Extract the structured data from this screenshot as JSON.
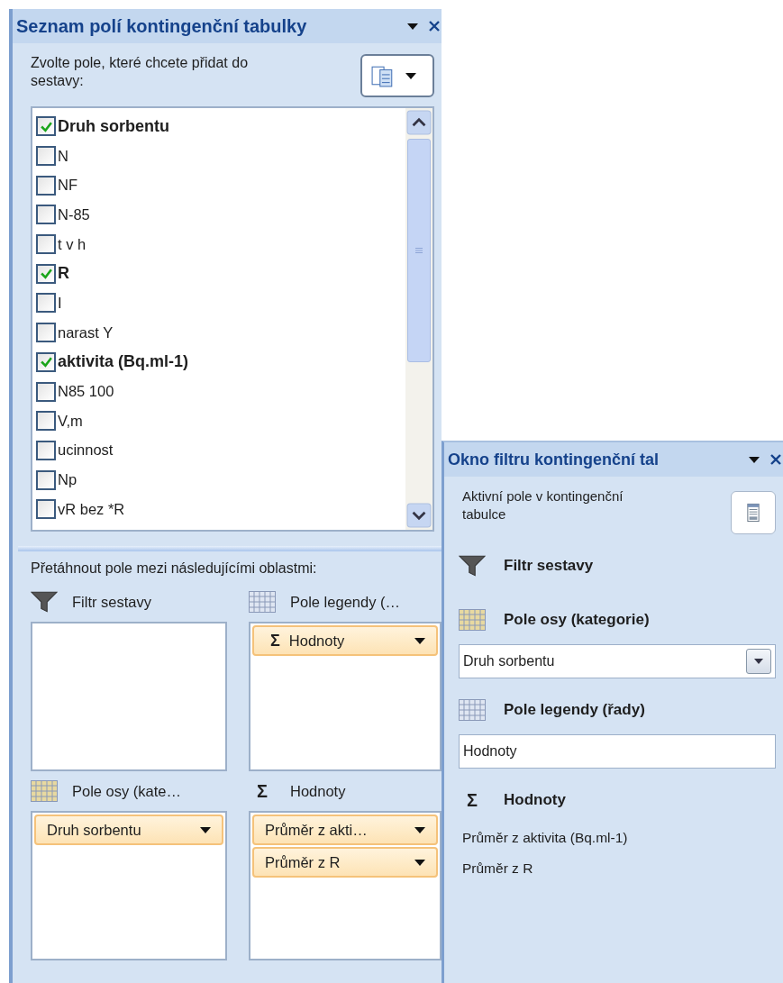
{
  "field_list_pane": {
    "title": "Seznam polí kontingenční tabulky",
    "instruction": "Zvolte pole, které chcete přidat do sestavy:",
    "fields": [
      {
        "label": "Druh sorbentu",
        "checked": true
      },
      {
        "label": "N",
        "checked": false
      },
      {
        "label": "NF",
        "checked": false
      },
      {
        "label": "N-85",
        "checked": false
      },
      {
        "label": "t v h",
        "checked": false
      },
      {
        "label": "R",
        "checked": true
      },
      {
        "label": "I",
        "checked": false
      },
      {
        "label": "narast Y",
        "checked": false
      },
      {
        "label": "aktivita (Bq.ml-1)",
        "checked": true
      },
      {
        "label": "N85 100",
        "checked": false
      },
      {
        "label": "V,m",
        "checked": false
      },
      {
        "label": "ucinnost",
        "checked": false
      },
      {
        "label": "Np",
        "checked": false
      },
      {
        "label": "vR bez *R",
        "checked": false
      }
    ],
    "drag_instruction": "Přetáhnout pole mezi následujícími oblastmi:",
    "areas": [
      {
        "kind": "filter",
        "title": "Filtr sestavy"
      },
      {
        "kind": "legend",
        "title": "Pole legendy (…",
        "items": [
          {
            "label": "Hodnoty",
            "symbol": "Σ"
          }
        ]
      },
      {
        "kind": "axis",
        "title": "Pole osy (kate…",
        "items": [
          {
            "label": "Druh sorbentu"
          }
        ]
      },
      {
        "kind": "values",
        "symbol": "Σ",
        "title": "Hodnoty",
        "items": [
          {
            "label": "Průměr z akti…"
          },
          {
            "label": "Průměr z R"
          }
        ]
      }
    ]
  },
  "filter_pane": {
    "title": "Okno filtru kontingenční tal",
    "instruction": "Aktivní pole v kontingenční tabulce",
    "sections": [
      {
        "kind": "filter",
        "title": "Filtr sestavy"
      },
      {
        "kind": "axis",
        "title": "Pole osy (kategorie)",
        "dropdown": "Druh sorbentu"
      },
      {
        "kind": "legend",
        "title": "Pole legendy (řady)",
        "field": "Hodnoty"
      },
      {
        "kind": "values",
        "symbol": "Σ",
        "title": "Hodnoty",
        "items": [
          "Průměr z aktivita (Bq.ml-1)",
          "Průměr z R"
        ]
      }
    ]
  }
}
